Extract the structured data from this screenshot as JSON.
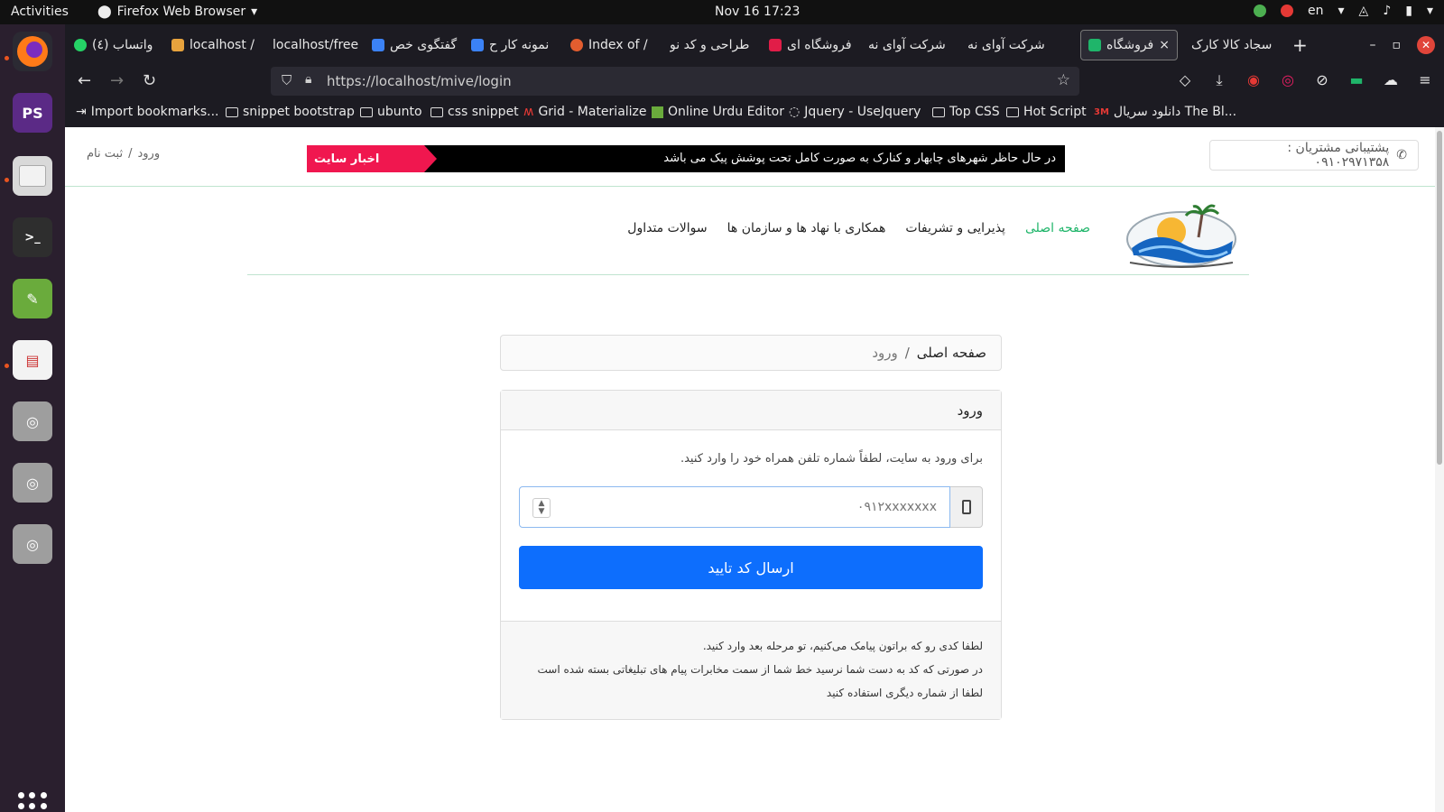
{
  "system": {
    "activities": "Activities",
    "app_name": "Firefox Web Browser",
    "clock": "Nov 16  17:23",
    "language": "en"
  },
  "tabs": [
    {
      "label": "واتساب (٤)",
      "color": "#25d366"
    },
    {
      "label": "localhost /",
      "color": "#e8a33d"
    },
    {
      "label": "localhost/free",
      "color": "#888888"
    },
    {
      "label": "گفتگوی خص",
      "color": "#3b82f6"
    },
    {
      "label": "نمونه کار ح",
      "color": "#3b82f6"
    },
    {
      "label": "Index of /",
      "color": "#e35d2f"
    },
    {
      "label": "طراحی و کد نو",
      "color": "#888888"
    },
    {
      "label": "فروشگاه ای",
      "color": "#e11d48"
    },
    {
      "label": "شرکت آوای نه",
      "color": "#888888"
    },
    {
      "label": "شرکت آوای نه",
      "color": "#888888"
    },
    {
      "label": "فروشگاه",
      "color": "#1fb56a"
    },
    {
      "label": "سجاد کالا کارک",
      "color": "#888888"
    }
  ],
  "tab_close": "×",
  "new_tab": "+",
  "window": {
    "minimize": "–",
    "maximize": "▫",
    "close": "✕"
  },
  "urlbar": {
    "url": "https://localhost/mive/login"
  },
  "bookmarks": [
    {
      "label": "Import bookmarks...",
      "icon": "import-icon"
    },
    {
      "label": "snippet bootstrap",
      "icon": "folder-icon"
    },
    {
      "label": "ubunto",
      "icon": "folder-icon"
    },
    {
      "label": "css snippet",
      "icon": "folder-icon"
    },
    {
      "label": "Grid - Materialize",
      "icon": "materialize-icon"
    },
    {
      "label": "Online Urdu Editor",
      "icon": "editor-icon"
    },
    {
      "label": "Jquery - UseJquery",
      "icon": "jquery-icon"
    },
    {
      "label": "Top CSS",
      "icon": "folder-icon"
    },
    {
      "label": "Hot Script",
      "icon": "folder-icon"
    },
    {
      "label": "دانلود سریال The Bl...",
      "icon": "site-icon"
    }
  ],
  "page": {
    "support": "پشتیبانی مشتریان : ۰۹۱۰۲۹۷۱۳۵۸",
    "news_label": "اخبار سایت",
    "news_text": "در حال حاظر شهرهای چابهار و کنارک به صورت کامل تحت پوشش پیک می باشد",
    "auth_login": "ورود",
    "auth_sep": "/",
    "auth_register": "ثبت نام",
    "menu": [
      "صفحه اصلی",
      "پذیرایی و تشریفات",
      "همکاری با نهاد ها و سازمان ها",
      "سوالات متداول"
    ],
    "breadcrumb": {
      "home": "صفحه اصلی",
      "sep": "/",
      "current": "ورود"
    },
    "card": {
      "title": "ورود",
      "description": "برای ورود به سایت، لطفاً شماره تلفن همراه خود را وارد کنید.",
      "phone_placeholder": "۰۹۱۲xxxxxxx",
      "submit_label": "ارسال کد تایید",
      "footer_lines": [
        "لطفا کدی رو که براتون پیامک می‌کنیم، تو مرحله بعد وارد کنید.",
        "در صورتی که کد به دست شما نرسید خط شما از سمت مخابرات پیام های تبلیغاتی بسته شده است",
        "لطفا از شماره دیگری استفاده کنید"
      ]
    }
  },
  "colors": {
    "accent_green": "#1fb56a",
    "primary_blue": "#0d6efd",
    "news_red": "#f0174f"
  }
}
